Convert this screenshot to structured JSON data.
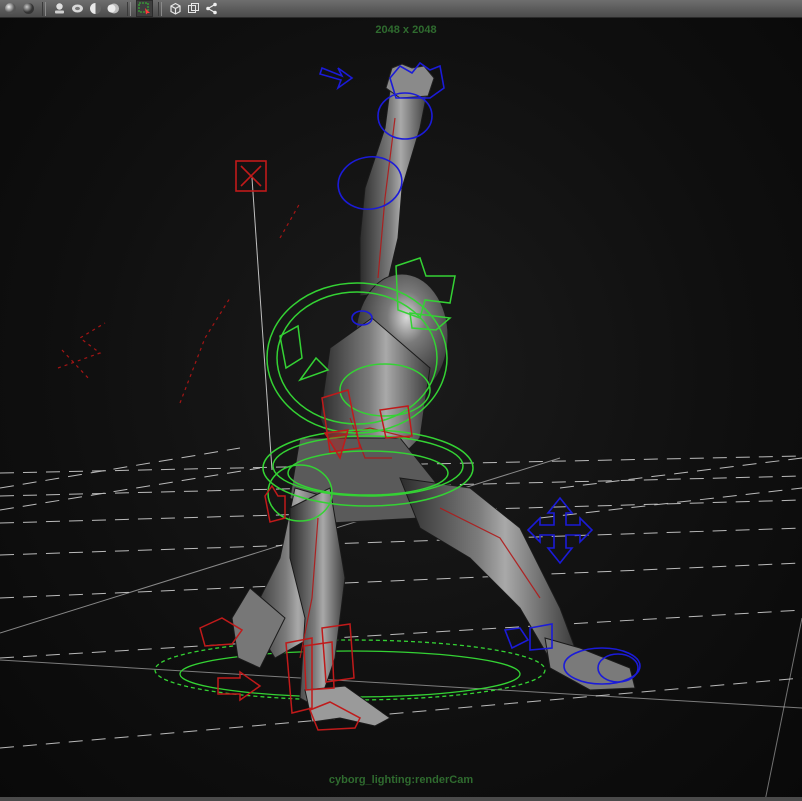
{
  "toolbar": {
    "buttons": [
      {
        "name": "smooth-shade-icon"
      },
      {
        "name": "flat-shade-icon"
      },
      {
        "name": "lights-icon"
      },
      {
        "name": "textured-icon"
      },
      {
        "name": "shadows-icon"
      },
      {
        "name": "ambient-occlusion-icon"
      },
      {
        "name": "select-camera-icon"
      },
      {
        "name": "isolate-select-icon"
      },
      {
        "name": "wireframe-on-shaded-icon"
      },
      {
        "name": "xray-icon"
      },
      {
        "name": "share-icon"
      }
    ]
  },
  "viewport": {
    "resolution_label": "2048 x 2048",
    "camera_label": "cyborg_lighting:renderCam",
    "colors": {
      "background": "#0c0c0c",
      "label": "#2f6b2f",
      "grid": "#d8d8d8",
      "fk_controls": "#1b1bd8",
      "ik_controls": "#c01a1a",
      "root_controls": "#34d234",
      "mesh": "#6a6a6a"
    }
  }
}
